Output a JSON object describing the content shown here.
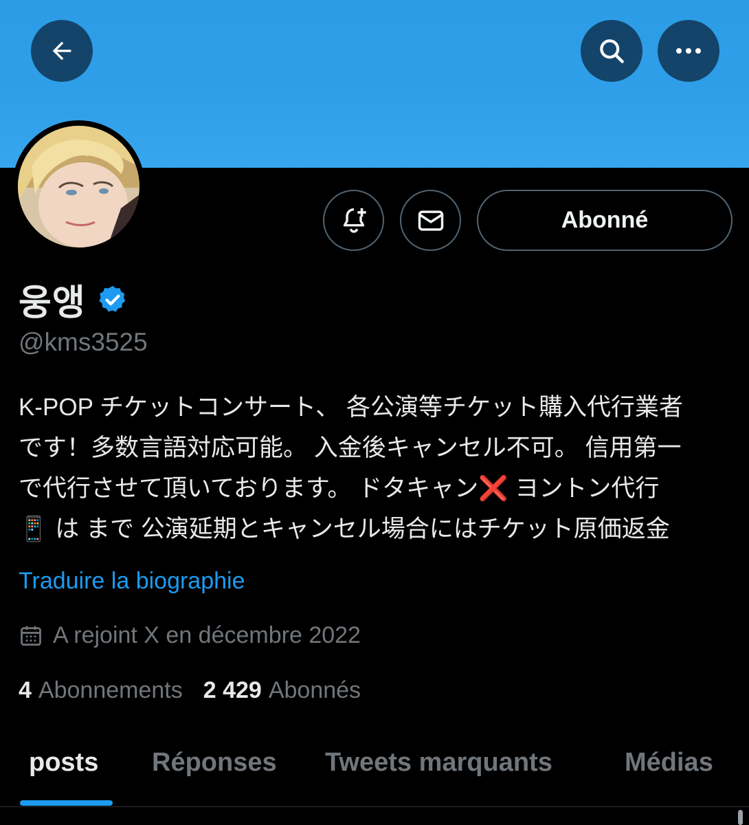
{
  "profile": {
    "display_name": "웅앵",
    "handle": "@kms3525",
    "bio_lines": [
      "K-POP チケットコンサート、 各公演等チケット購入代行業者",
      "です！多数言語対応可能。 入金後キャンセル不可。 信用第一",
      "で代行させて頂いております。 ドタキャン❌ ヨントン代行",
      "📱 は まで 公演延期とキャンセル場合にはチケット原価返金"
    ],
    "translate_label": "Traduire la biographie",
    "joined": "A rejoint X en décembre 2022",
    "following_count": "4",
    "following_label": "Abonnements",
    "followers_count": "2 429",
    "followers_label": "Abonnés"
  },
  "actions": {
    "follow_label": "Abonné"
  },
  "tabs": [
    {
      "label": "posts",
      "active": true
    },
    {
      "label": "Réponses",
      "active": false
    },
    {
      "label": "Tweets marquants",
      "active": false
    },
    {
      "label": "Médias",
      "active": false
    }
  ],
  "colors": {
    "banner": "#2f9fe9",
    "accent": "#1d9bf0",
    "background": "#000000",
    "muted_text": "#71767b"
  },
  "icons": [
    "back-arrow-icon",
    "search-icon",
    "more-icon",
    "notification-bell-icon",
    "mail-icon",
    "verified-badge-icon",
    "calendar-icon"
  ]
}
